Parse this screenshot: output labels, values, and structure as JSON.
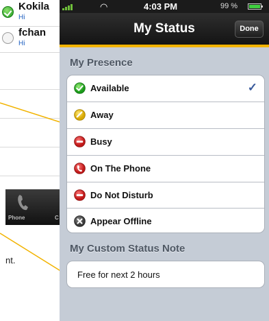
{
  "background": {
    "contacts": [
      {
        "name": "Kokila",
        "message": "Hi",
        "status": "online"
      },
      {
        "name": "fchan",
        "message": "Hi",
        "status": "offline"
      }
    ],
    "tabs": [
      {
        "label": "Phone",
        "icon": "phone-handset-icon"
      },
      {
        "label": "C",
        "icon": ""
      }
    ],
    "annotation_fragment": "nt."
  },
  "statusbar": {
    "time": "4:03 PM",
    "battery": "99 %"
  },
  "nav": {
    "title": "My Status",
    "done_label": "Done"
  },
  "presence": {
    "header": "My Presence",
    "items": [
      {
        "label": "Available",
        "icon": "available-green-check-icon",
        "selected": true
      },
      {
        "label": "Away",
        "icon": "away-yellow-icon",
        "selected": false
      },
      {
        "label": "Busy",
        "icon": "busy-red-icon",
        "selected": false
      },
      {
        "label": "On The Phone",
        "icon": "on-the-phone-red-icon",
        "selected": false
      },
      {
        "label": "Do Not Disturb",
        "icon": "do-not-disturb-red-icon",
        "selected": false
      },
      {
        "label": "Appear Offline",
        "icon": "appear-offline-grey-icon",
        "selected": false
      }
    ],
    "check_mark": "✓"
  },
  "custom_note": {
    "header": "My Custom Status Note",
    "value": "Free for next 2 hours"
  },
  "colors": {
    "accent": "#f2b300",
    "callout_line": "#f2b300",
    "available": "#1c9a1c",
    "away": "#e0b600",
    "busy": "#c81e1e",
    "offline": "#555555"
  }
}
